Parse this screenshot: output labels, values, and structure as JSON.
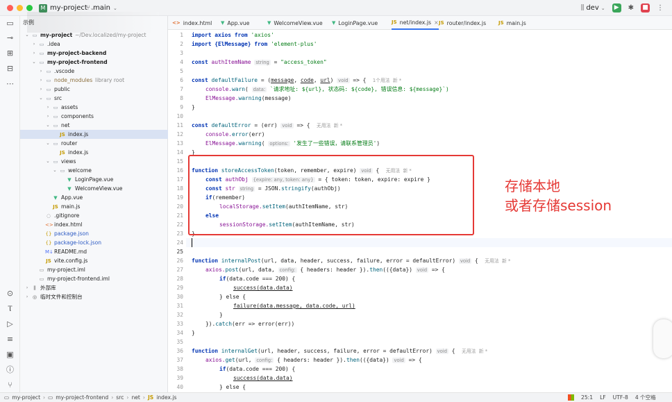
{
  "titlebar": {
    "project_badge": "M",
    "project": "my-project",
    "branch": "main",
    "right_branch": "dev"
  },
  "project_panel": {
    "title": "示例",
    "tree": [
      {
        "name": "my-project",
        "hint": "~/Dev.localized/my-project",
        "icon": "folder",
        "bold": true
      },
      {
        "name": ".idea",
        "icon": "folder"
      },
      {
        "name": "my-project-backend",
        "icon": "folder",
        "bold": true
      },
      {
        "name": "my-project-frontend",
        "icon": "folder",
        "bold": true
      },
      {
        "name": ".vscode",
        "icon": "folder"
      },
      {
        "name": "node_modules",
        "hint": "library root",
        "icon": "folder",
        "muted": true
      },
      {
        "name": "public",
        "icon": "folder"
      },
      {
        "name": "src",
        "icon": "folder"
      },
      {
        "name": "assets",
        "icon": "folder"
      },
      {
        "name": "components",
        "icon": "folder"
      },
      {
        "name": "net",
        "icon": "folder"
      },
      {
        "name": "index.js",
        "icon": "js",
        "selected": true
      },
      {
        "name": "router",
        "icon": "folder"
      },
      {
        "name": "index.js",
        "icon": "js"
      },
      {
        "name": "views",
        "icon": "folder"
      },
      {
        "name": "welcome",
        "icon": "folder"
      },
      {
        "name": "LoginPage.vue",
        "icon": "vue"
      },
      {
        "name": "WelcomeView.vue",
        "icon": "vue"
      },
      {
        "name": "App.vue",
        "icon": "vue"
      },
      {
        "name": "main.js",
        "icon": "js"
      },
      {
        "name": ".gitignore",
        "icon": "file"
      },
      {
        "name": "index.html",
        "icon": "html"
      },
      {
        "name": "package.json",
        "icon": "json",
        "blue": true
      },
      {
        "name": "package-lock.json",
        "icon": "json",
        "blue": true
      },
      {
        "name": "README.md",
        "icon": "md"
      },
      {
        "name": "vite.config.js",
        "icon": "js"
      },
      {
        "name": "my-project.iml",
        "icon": "iml"
      },
      {
        "name": "my-project-frontend.iml",
        "icon": "iml"
      },
      {
        "name": "外部库",
        "icon": "lib"
      },
      {
        "name": "临时文件和控制台",
        "icon": "scratch"
      }
    ]
  },
  "tabs": [
    {
      "label": "index.html",
      "icon": "html"
    },
    {
      "label": "App.vue",
      "icon": "vue"
    },
    {
      "label": "WelcomeView.vue",
      "icon": "vue"
    },
    {
      "label": "LoginPage.vue",
      "icon": "vue"
    },
    {
      "label": "net/index.js",
      "icon": "js",
      "active": true
    },
    {
      "label": "router/index.js",
      "icon": "js"
    },
    {
      "label": "main.js",
      "icon": "js"
    }
  ],
  "code": {
    "line_numbers": [
      "1",
      "2",
      "3",
      "4",
      "5",
      "6",
      "7",
      "8",
      "9",
      "10",
      "11",
      "12",
      "13",
      "14",
      "15",
      "16",
      "17",
      "18",
      "19",
      "20",
      "21",
      "22",
      "23",
      "24",
      "25",
      "26",
      "27",
      "28",
      "29",
      "30",
      "31",
      "32",
      "33",
      "34",
      "35",
      "36",
      "37",
      "38",
      "39",
      "40",
      "41"
    ],
    "l1_a": "import axios from",
    "l1_b": "'axios'",
    "l2_a": "import {ElMessage} from",
    "l2_b": "'element-plus'",
    "l4_a": "const",
    "l4_b": "authItemName",
    "l4_hint": "string",
    "l4_c": "=",
    "l4_d": "\"access_token\"",
    "l6_a": "const",
    "l6_b": "defaultFailure",
    "l6_c": "= (",
    "l6_p1": "message",
    "l6_p2": "code",
    "l6_p3": "url",
    "l6_hint": "void",
    "l6_d": "=> {",
    "l6_usage": "1个用法  新 *",
    "l7_a": "console.",
    "l7_b": "warn",
    "l7_c": "(",
    "l7_hint": "data:",
    "l7_d": "`请求地址: ${url}, 状态码: ${code}, 错误信息: ${message}`)",
    "l8_a": "ElMessage.",
    "l8_b": "warning",
    "l8_c": "(message)",
    "l9": "}",
    "l11_a": "const",
    "l11_b": "defaultError",
    "l11_c": "= (err)",
    "l11_hint": "void",
    "l11_d": "=> {",
    "l11_usage": "无用法  新 *",
    "l12_a": "console.",
    "l12_b": "error",
    "l12_c": "(err)",
    "l13_a": "ElMessage.",
    "l13_b": "warning",
    "l13_c": "(",
    "l13_hint": "options:",
    "l13_d": "'发生了一些错误，请联系管理员'",
    "l13_e": ")",
    "l14": "}",
    "l16_a": "function",
    "l16_b": "storeAccessToken",
    "l16_c": "(token, remember, expire)",
    "l16_hint": "void",
    "l16_d": "{",
    "l16_usage": "无用法  新 *",
    "l17_a": "const",
    "l17_b": "authObj",
    "l17_hint": "{expire: any, token: any}",
    "l17_c": "= { token: token, expire: expire }",
    "l18_a": "const",
    "l18_b": "str",
    "l18_hint": "string",
    "l18_c": "= JSON.",
    "l18_d": "stringify",
    "l18_e": "(authObj)",
    "l19_a": "if",
    "l19_b": "(remember)",
    "l20_a": "localStorage.",
    "l20_b": "setItem",
    "l20_c": "(authItemName, str)",
    "l21": "else",
    "l22_a": "sessionStorage.",
    "l22_b": "setItem",
    "l22_c": "(authItemName, str)",
    "l23": "}",
    "l27_a": "function",
    "l27_b": "internalPost",
    "l27_c": "(url, data, header, success, failure, error = defaultError)",
    "l27_hint": "void",
    "l27_d": "{",
    "l27_usage": "无用法  新 *",
    "l28_a": "axios.",
    "l28_b": "post",
    "l28_c": "(url, data,",
    "l28_hint": "config:",
    "l28_d": "{ headers: header }).",
    "l28_e": "then",
    "l28_f": "(({data})",
    "l28_hint2": "void",
    "l28_g": "=> {",
    "l29_a": "if",
    "l29_b": "(data.code === 200) {",
    "l30": "success(data.data)",
    "l31": "} else {",
    "l32": "failure(data.message, data.code, url)",
    "l33": "}",
    "l34_a": "}).",
    "l34_b": "catch",
    "l34_c": "(err => error(err))",
    "l35": "}",
    "l37_a": "function",
    "l37_b": "internalGet",
    "l37_c": "(url, header, success, failure, error = defaultError)",
    "l37_hint": "void",
    "l37_d": "{",
    "l37_usage": "无用法  新 *",
    "l38_a": "axios.",
    "l38_b": "get",
    "l38_c": "(url,",
    "l38_hint": "config:",
    "l38_d": "{ headers: header }).",
    "l38_e": "then",
    "l38_f": "(({data})",
    "l38_hint2": "void",
    "l38_g": "=> {",
    "l39_a": "if",
    "l39_b": "(data.code === 200) {",
    "l40": "success(data.data)",
    "l41": "} else {"
  },
  "annotation": {
    "line1": "存储本地",
    "line2": "或者存储session",
    "color": "#e53935"
  },
  "statusbar": {
    "crumbs": [
      "my-project",
      "my-project-frontend",
      "src",
      "net",
      "index.js"
    ],
    "position": "25:1",
    "line_sep": "LF",
    "encoding": "UTF-8",
    "indent": "4 个空格"
  }
}
